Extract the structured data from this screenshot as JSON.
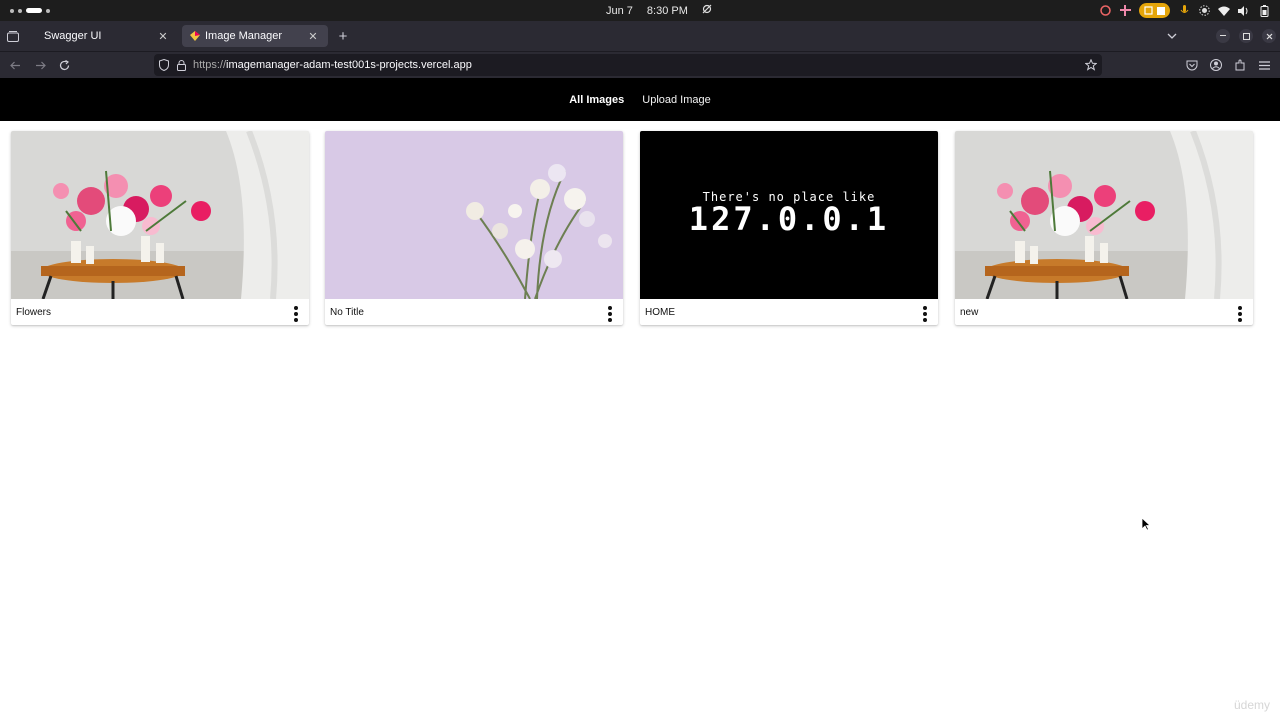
{
  "system_bar": {
    "date": "Jun 7",
    "time": "8:30 PM"
  },
  "browser": {
    "tabs": [
      {
        "title": "Swagger UI",
        "active": false
      },
      {
        "title": "Image Manager",
        "active": true
      }
    ],
    "url_scheme": "https://",
    "url_host": "imagemanager-adam-test001s-projects.vercel.app"
  },
  "nav": {
    "all_images": "All Images",
    "upload_image": "Upload Image"
  },
  "images": [
    {
      "title": "Flowers"
    },
    {
      "title": "No Title"
    },
    {
      "title": "HOME",
      "image_text_line1": "There's no place like",
      "image_text_line2": "127.0.0.1"
    },
    {
      "title": "new"
    }
  ],
  "watermark": "üdemy",
  "colors": {
    "page_nav_bg": "#000000",
    "browser_chrome": "#2b2a33",
    "accent_pill": "#e5a50a"
  }
}
